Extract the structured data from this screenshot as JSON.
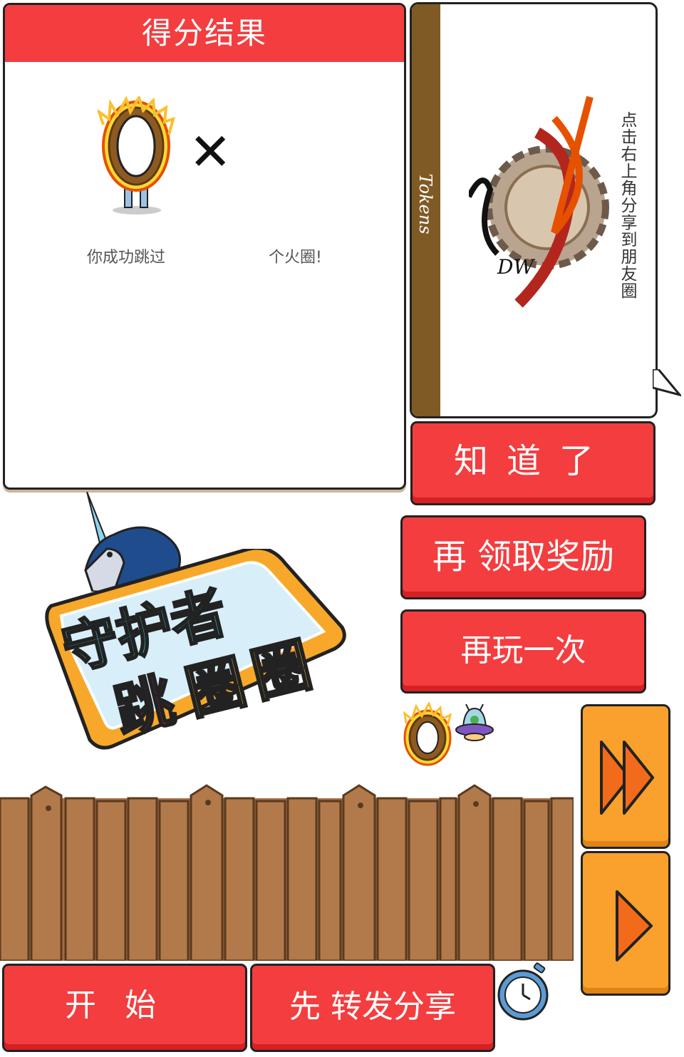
{
  "score_panel": {
    "title": "得分结果",
    "result_prefix": "你成功跳过",
    "result_suffix": "个火圈!",
    "times_symbol": "✕"
  },
  "share_card": {
    "brand": "Tokens",
    "tip": "点击右上角分享到朋友圈",
    "logo_text": "DW"
  },
  "buttons": {
    "know": "知道了",
    "reward": "再 领取奖励",
    "again": "再玩一次",
    "start": "开始",
    "share": "先 转发分享"
  },
  "logo": {
    "line1": "守护者",
    "line2a": "跳",
    "line2b": "圈",
    "line2c": "圈"
  },
  "icons": [
    "fire-ring-icon",
    "ufo-icon",
    "fast-forward-icon",
    "play-icon",
    "stopwatch-icon",
    "unicorn-icon"
  ],
  "colors": {
    "red": "#f33d3f",
    "orange": "#f9a12c",
    "wood": "#a36d43",
    "brown": "#7f5a24"
  }
}
